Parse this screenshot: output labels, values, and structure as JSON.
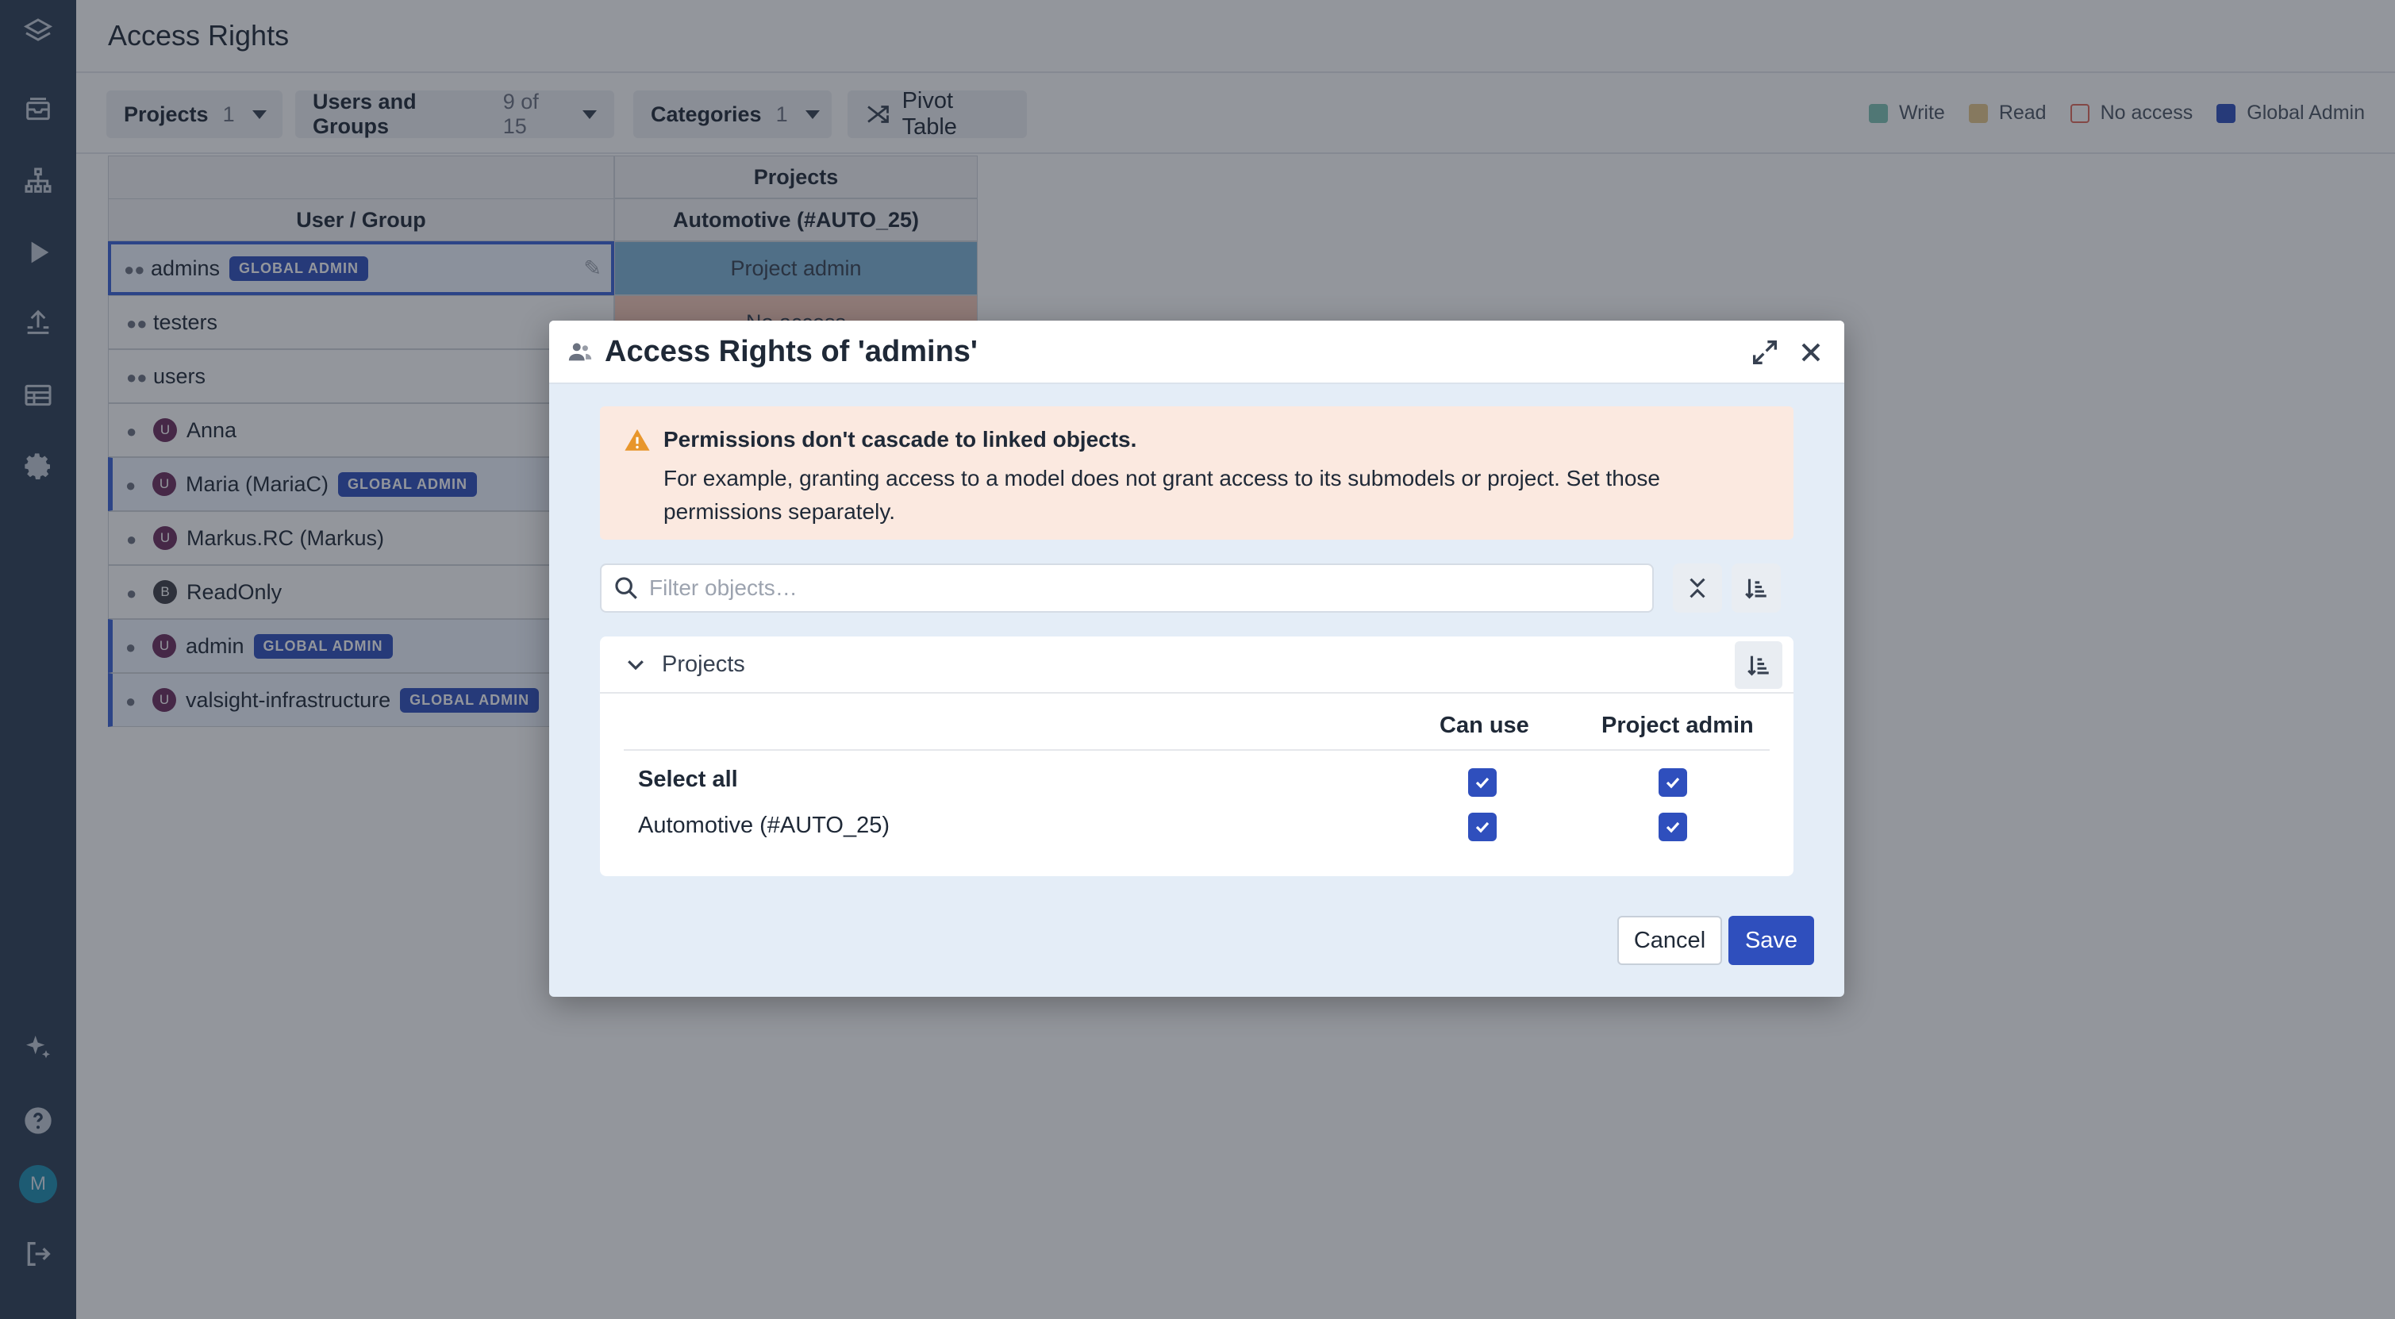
{
  "sidebar": {
    "icons": [
      "layers-icon",
      "inbox-icon",
      "hierarchy-icon",
      "play-icon",
      "upload-icon",
      "table-icon",
      "settings-icon",
      "sparkle-icon",
      "help-icon",
      "avatar",
      "logout-icon"
    ],
    "avatar_letter": "M"
  },
  "page": {
    "title": "Access Rights"
  },
  "filters": {
    "projects": {
      "label": "Projects",
      "count": "1"
    },
    "users_groups": {
      "label": "Users and Groups",
      "count": "9 of 15"
    },
    "categories": {
      "label": "Categories",
      "count": "1"
    },
    "pivot": {
      "label": "Pivot Table"
    }
  },
  "legend": [
    {
      "label": "Write",
      "color": "#7fc4b4"
    },
    {
      "label": "Read",
      "color": "#e7c88a"
    },
    {
      "label": "No access",
      "color": "#ffffff"
    },
    {
      "label": "Global Admin",
      "color": "#2f4fbd"
    }
  ],
  "grid": {
    "group_header": "Projects",
    "user_header": "User / Group",
    "project_header": "Automotive (#AUTO_25)",
    "rows": [
      {
        "name": "admins",
        "type": "group",
        "badge": "GLOBAL ADMIN",
        "value": "Project admin"
      },
      {
        "name": "testers",
        "type": "group",
        "badge": "",
        "value": "No access"
      },
      {
        "name": "users",
        "type": "group",
        "badge": "",
        "value": ""
      },
      {
        "name": "Anna",
        "type": "user",
        "initial": "U",
        "badge": "",
        "value": ""
      },
      {
        "name": "Maria (MariaC)",
        "type": "user",
        "initial": "U",
        "badge": "GLOBAL ADMIN",
        "value": ""
      },
      {
        "name": "Markus.RC (Markus)",
        "type": "user",
        "initial": "U",
        "badge": "",
        "value": ""
      },
      {
        "name": "ReadOnly",
        "type": "user",
        "initial": "B",
        "badge": "",
        "value": ""
      },
      {
        "name": "admin",
        "type": "user",
        "initial": "U",
        "badge": "GLOBAL ADMIN",
        "value": ""
      },
      {
        "name": "valsight-infrastructure",
        "type": "user",
        "initial": "U",
        "badge": "GLOBAL ADMIN",
        "value": ""
      }
    ]
  },
  "modal": {
    "title": "Access Rights of 'admins'",
    "alert_title": "Permissions don't cascade to linked objects.",
    "alert_body": "For example, granting access to a model does not grant access to its submodels or project. Set those permissions separately.",
    "filter_placeholder": "Filter objects…",
    "section_title": "Projects",
    "col_can_use": "Can use",
    "col_project_admin": "Project admin",
    "select_all": "Select all",
    "project_name": "Automotive (#AUTO_25)",
    "cancel": "Cancel",
    "save": "Save"
  }
}
